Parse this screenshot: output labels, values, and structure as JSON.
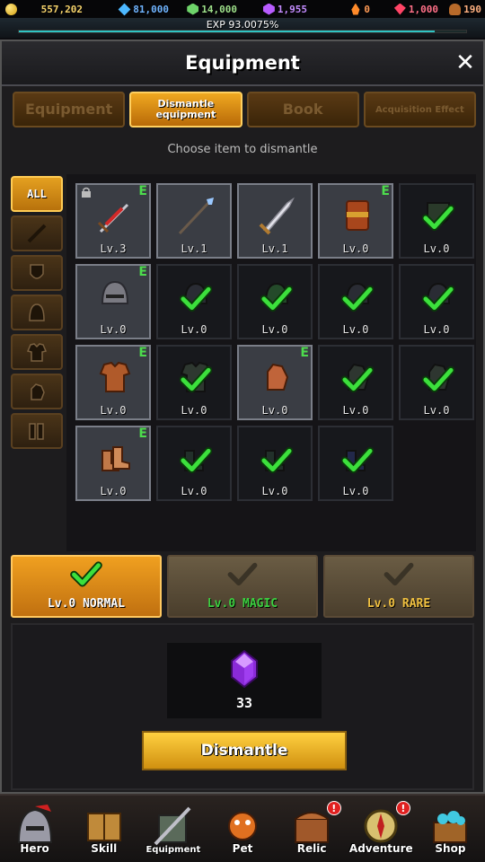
{
  "resources": [
    {
      "icon": "gold-coin-icon",
      "cls": "gold-ic",
      "value": "557,202",
      "color": "#f5d26a"
    },
    {
      "icon": "diamond-icon",
      "cls": "diamond-ic",
      "value": "81,000",
      "color": "#6fb4ff"
    },
    {
      "icon": "green-gem-icon",
      "cls": "green-ic",
      "value": "14,000",
      "color": "#9ee08a"
    },
    {
      "icon": "purple-gem-icon",
      "cls": "purple-ic",
      "value": "1,955",
      "color": "#c48cff"
    },
    {
      "icon": "flame-icon",
      "cls": "fire-ic",
      "value": "0",
      "color": "#ff9a55"
    },
    {
      "icon": "ruby-icon",
      "cls": "ruby-ic",
      "value": "1,000",
      "color": "#ff7088"
    },
    {
      "icon": "bread-icon",
      "cls": "bread-ic",
      "value": "190",
      "color": "#ffb080"
    }
  ],
  "exp": {
    "label": "EXP 93.0075%",
    "fraction": 0.930075
  },
  "panel": {
    "title": "Equipment",
    "close": "✕"
  },
  "tabs": [
    {
      "label": "Equipment",
      "active": false
    },
    {
      "label": "Dismantle equipment",
      "active": true
    },
    {
      "label": "Book",
      "active": false
    },
    {
      "label": "Acquisition Effect",
      "active": false
    }
  ],
  "hint": "Choose item to dismantle",
  "filters": [
    {
      "label": "ALL",
      "icon": "",
      "active": true
    },
    {
      "label": "",
      "icon": "sword-icon",
      "active": false
    },
    {
      "label": "",
      "icon": "shield-icon",
      "active": false
    },
    {
      "label": "",
      "icon": "helmet-icon",
      "active": false
    },
    {
      "label": "",
      "icon": "armor-icon",
      "active": false
    },
    {
      "label": "",
      "icon": "gloves-icon",
      "active": false
    },
    {
      "label": "",
      "icon": "boots-icon",
      "active": false
    }
  ],
  "items": [
    {
      "name": "red-sword-item",
      "art": "sword-red",
      "level": "Lv.3",
      "equipped": true,
      "locked": true,
      "checked": false,
      "highlight": true
    },
    {
      "name": "spear-item",
      "art": "spear",
      "level": "Lv.1",
      "equipped": false,
      "locked": false,
      "checked": false,
      "highlight": true
    },
    {
      "name": "greatsword-item",
      "art": "greatsword",
      "level": "Lv.1",
      "equipped": false,
      "locked": false,
      "checked": false,
      "highlight": true
    },
    {
      "name": "wooden-shield-item",
      "art": "shield-wood",
      "level": "Lv.0",
      "equipped": true,
      "locked": false,
      "checked": false,
      "highlight": true
    },
    {
      "name": "shield-item",
      "art": "shield-dark",
      "level": "Lv.0",
      "equipped": false,
      "locked": false,
      "checked": true,
      "highlight": false
    },
    {
      "name": "iron-helmet-item",
      "art": "helmet",
      "level": "Lv.0",
      "equipped": true,
      "locked": false,
      "checked": false,
      "highlight": true
    },
    {
      "name": "helmet-item",
      "art": "helmet-dark",
      "level": "Lv.0",
      "equipped": false,
      "locked": false,
      "checked": true,
      "highlight": false
    },
    {
      "name": "helmet-item",
      "art": "helmet-green",
      "level": "Lv.0",
      "equipped": false,
      "locked": false,
      "checked": true,
      "highlight": false
    },
    {
      "name": "helmet-item",
      "art": "helmet-dark",
      "level": "Lv.0",
      "equipped": false,
      "locked": false,
      "checked": true,
      "highlight": false
    },
    {
      "name": "helmet-item",
      "art": "helmet-dark",
      "level": "Lv.0",
      "equipped": false,
      "locked": false,
      "checked": true,
      "highlight": false
    },
    {
      "name": "leather-armor-item",
      "art": "armor",
      "level": "Lv.0",
      "equipped": true,
      "locked": false,
      "checked": false,
      "highlight": true
    },
    {
      "name": "armor-item",
      "art": "armor-dark",
      "level": "Lv.0",
      "equipped": false,
      "locked": false,
      "checked": true,
      "highlight": false
    },
    {
      "name": "leather-gloves-item",
      "art": "gloves",
      "level": "Lv.0",
      "equipped": true,
      "locked": false,
      "checked": false,
      "highlight": true
    },
    {
      "name": "gloves-item",
      "art": "gloves-dark",
      "level": "Lv.0",
      "equipped": false,
      "locked": false,
      "checked": true,
      "highlight": false
    },
    {
      "name": "gloves-item",
      "art": "gloves-dark",
      "level": "Lv.0",
      "equipped": false,
      "locked": false,
      "checked": true,
      "highlight": false
    },
    {
      "name": "leather-boots-item",
      "art": "boots",
      "level": "Lv.0",
      "equipped": true,
      "locked": false,
      "checked": false,
      "highlight": true
    },
    {
      "name": "boots-item",
      "art": "boots-dark",
      "level": "Lv.0",
      "equipped": false,
      "locked": false,
      "checked": true,
      "highlight": false
    },
    {
      "name": "boots-item",
      "art": "boots-dark",
      "level": "Lv.0",
      "equipped": false,
      "locked": false,
      "checked": true,
      "highlight": false
    },
    {
      "name": "boots-item",
      "art": "boots-blue",
      "level": "Lv.0",
      "equipped": false,
      "locked": false,
      "checked": true,
      "highlight": false
    }
  ],
  "equipped_marker": "E",
  "grades": [
    {
      "name": "grade-normal-button",
      "cls": "normal",
      "label": "Lv.0 NORMAL",
      "checked": true
    },
    {
      "name": "grade-magic-button",
      "cls": "magic",
      "label": "Lv.0 MAGIC",
      "checked": false
    },
    {
      "name": "grade-rare-button",
      "cls": "rare",
      "label": "Lv.0 RARE",
      "checked": false
    }
  ],
  "reward": {
    "icon": "purple-crystal-icon",
    "amount": "33"
  },
  "dismantle_button": "Dismantle",
  "nav": [
    {
      "name": "nav-hero",
      "icon": "hero-helmet-icon",
      "label": "Hero",
      "badge": "",
      "active": false
    },
    {
      "name": "nav-skill",
      "icon": "skill-book-icon",
      "label": "Skill",
      "badge": "",
      "active": false
    },
    {
      "name": "nav-equipment",
      "icon": "equipment-icon",
      "label": "Equipment",
      "badge": "",
      "active": true
    },
    {
      "name": "nav-pet",
      "icon": "pet-icon",
      "label": "Pet",
      "badge": "",
      "active": false
    },
    {
      "name": "nav-relic",
      "icon": "relic-chest-icon",
      "label": "Relic",
      "badge": "!",
      "active": false
    },
    {
      "name": "nav-adventure",
      "icon": "compass-icon",
      "label": "Adventure",
      "badge": "!",
      "active": false
    },
    {
      "name": "nav-shop",
      "icon": "shop-chest-icon",
      "label": "Shop",
      "badge": "",
      "active": false
    }
  ]
}
